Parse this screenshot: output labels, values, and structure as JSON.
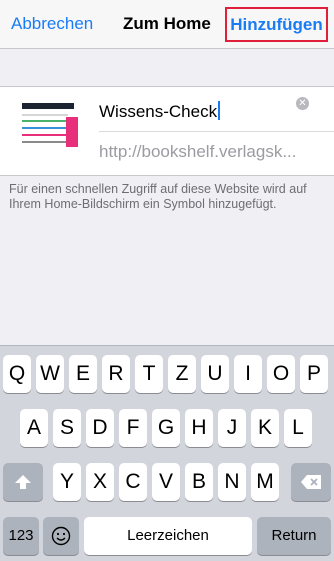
{
  "navbar": {
    "cancel_label": "Abbrechen",
    "title": "Zum Home",
    "add_label": "Hinzufügen"
  },
  "form": {
    "name_value": "Wissens-Check",
    "url_value": "http://bookshelf.verlagsk...",
    "clear_icon": "clear-x-icon",
    "hint": "Für einen schnellen Zugriff auf diese Website wird auf Ihrem Home-Bildschirm ein Symbol hinzugefügt."
  },
  "keyboard": {
    "row1": [
      "Q",
      "W",
      "E",
      "R",
      "T",
      "Z",
      "U",
      "I",
      "O",
      "P"
    ],
    "row2": [
      "A",
      "S",
      "D",
      "F",
      "G",
      "H",
      "J",
      "K",
      "L"
    ],
    "row3": [
      "Y",
      "X",
      "C",
      "V",
      "B",
      "N",
      "M"
    ],
    "shift_icon": "shift-arrow-icon",
    "delete_icon": "backspace-icon",
    "numbers_label": "123",
    "emoji_icon": "emoji-smiley-icon",
    "space_label": "Leerzeichen",
    "return_label": "Return"
  },
  "colors": {
    "accent": "#1a7cf5",
    "highlight_border": "#e0203a"
  }
}
